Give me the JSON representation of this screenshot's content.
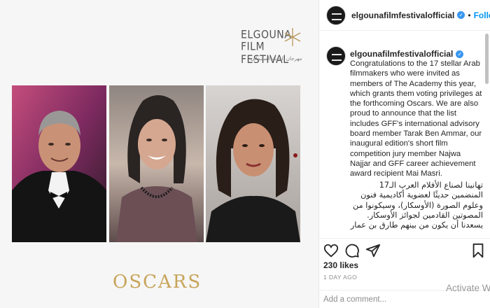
{
  "post": {
    "brand": {
      "line1": "ELGOUNA",
      "line2": "FILM FESTIVAL",
      "arabic": "مهرجان الجونة السينمائي"
    },
    "photos": [
      "portrait-1",
      "portrait-2",
      "portrait-3"
    ],
    "oscars_logo": "OSCARS"
  },
  "header": {
    "username": "elgounafilmfestivalofficial",
    "separator": "•",
    "follow_label": "Follow"
  },
  "caption": {
    "username": "elgounafilmfestivalofficial",
    "text_en": "Congratulations to the 17 stellar Arab filmmakers who were invited as members of The Academy this year, which grants them voting privileges at the forthcoming Oscars. We are also proud to announce that the list includes GFF's international advisory board member Tarak Ben Ammar, our inaugural edition's short film competition jury member Najwa Najjar and GFF career achievement award recipient Mai Masri.",
    "text_ar": "تهانينا لصناع الأفلام العرب الـ17 المنضمين حديثًا لعضوية أكاديمية فنون وعلوم الصورة (الأوسكار)، وسيكونوا من المصوتين القادمين لجوائز الأوسكار. يسعدنا أن يكون من بينهم طارق بن عمار"
  },
  "actions": {
    "icons": [
      "heart-icon",
      "comment-icon",
      "share-icon",
      "bookmark-icon"
    ]
  },
  "likes": "230 likes",
  "date": "1 DAY AGO",
  "comment": {
    "placeholder": "Add a comment..."
  },
  "overlay": {
    "activate": "Activate W"
  },
  "colors": {
    "accent": "#0095f6",
    "verified": "#3897f0",
    "oscars_gold": "#c8a45a",
    "text": "#262626",
    "muted": "#8e8e8e"
  }
}
